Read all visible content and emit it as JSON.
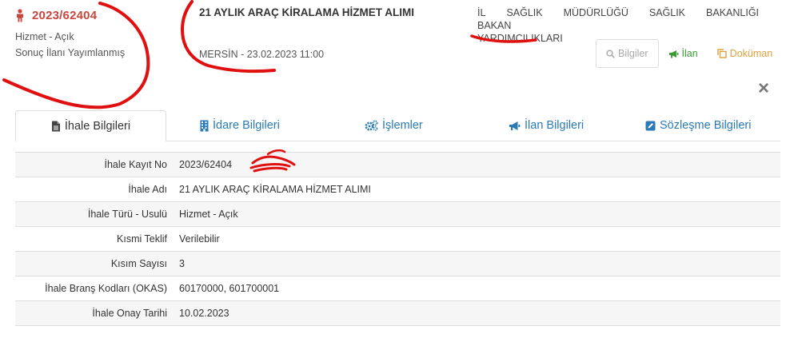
{
  "header": {
    "record_no": "2023/62404",
    "type_method": "Hizmet - Açık",
    "status": "Sonuç İlanı Yayımlanmış",
    "title": "21 AYLIK ARAÇ KİRALAMA HİZMET ALIMI",
    "location_date": "MERSİN - 23.02.2023 11:00",
    "agency_words": [
      "İL",
      "SAĞLIK",
      "MÜDÜRLÜĞÜ",
      "SAĞLIK",
      "BAKANLIĞI",
      "BAKAN"
    ],
    "agency_line2": "YARDIMCILIKLARI"
  },
  "buttons": {
    "info": "Bilgiler",
    "ilan": "İlan",
    "dokuman": "Doküman"
  },
  "tabs": [
    {
      "label": "İhale Bilgileri",
      "icon": "file-icon"
    },
    {
      "label": "İdare Bilgileri",
      "icon": "building-icon"
    },
    {
      "label": "İşlemler",
      "icon": "gears-icon"
    },
    {
      "label": "İlan Bilgileri",
      "icon": "bullhorn-icon"
    },
    {
      "label": "Sözleşme Bilgileri",
      "icon": "edit-icon"
    }
  ],
  "details": [
    {
      "label": "İhale Kayıt No",
      "value": "2023/62404"
    },
    {
      "label": "İhale Adı",
      "value": "21 AYLIK ARAÇ KİRALAMA HİZMET ALIMI"
    },
    {
      "label": "İhale Türü - Usulü",
      "value": "Hizmet - Açık"
    },
    {
      "label": "Kısmi Teklif",
      "value": "Verilebilir"
    },
    {
      "label": "Kısım Sayısı",
      "value": "3"
    },
    {
      "label": "İhale Branş Kodları (OKAS)",
      "value": "60170000, 601700001"
    },
    {
      "label": "İhale Onay Tarihi",
      "value": "10.02.2023"
    }
  ],
  "colors": {
    "accent_red": "#c9463d",
    "link_blue": "#2a7ab5",
    "ilan_green": "#3d9b35",
    "doc_orange": "#e0a03c",
    "scribble": "#e01010"
  }
}
